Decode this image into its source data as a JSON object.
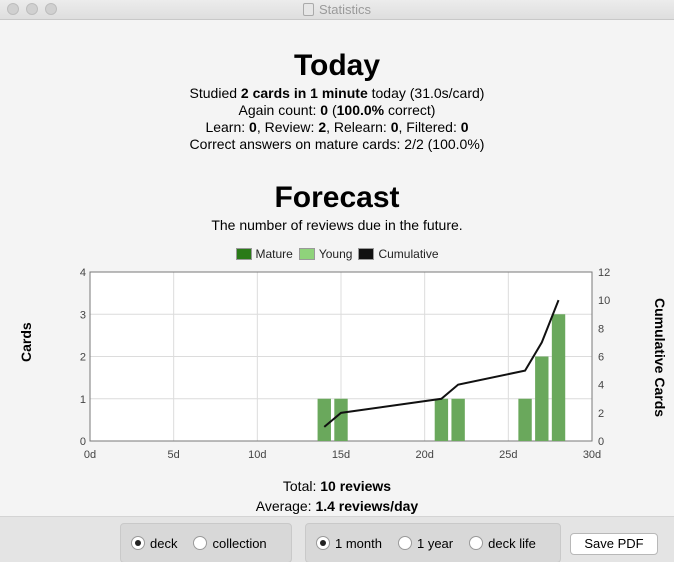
{
  "window": {
    "title": "Statistics"
  },
  "today": {
    "heading": "Today",
    "studied": {
      "prefix": "Studied ",
      "bold": "2 cards in 1 minute",
      "suffix": " today (31.0s/card)"
    },
    "again": {
      "prefix": "Again count: ",
      "count": "0",
      "mid": " (",
      "pct": "100.0%",
      "suffix": " correct)"
    },
    "breakdown": {
      "learn_label": "Learn: ",
      "learn": "0",
      "review_label": ", Review: ",
      "review": "2",
      "relearn_label": ", Relearn: ",
      "relearn": "0",
      "filtered_label": ", Filtered: ",
      "filtered": "0"
    },
    "mature": "Correct answers on mature cards: 2/2 (100.0%)"
  },
  "forecast": {
    "heading": "Forecast",
    "subtitle": "The number of reviews due in the future.",
    "legend": [
      {
        "label": "Mature",
        "color": "#2a7a18"
      },
      {
        "label": "Young",
        "color": "#8fd37b"
      },
      {
        "label": "Cumulative",
        "color": "#111111"
      }
    ],
    "total": {
      "prefix": "Total: ",
      "value": "10 reviews"
    },
    "average": {
      "prefix": "Average: ",
      "value": "1.4 reviews/day"
    }
  },
  "chart_data": {
    "type": "bar",
    "x_ticks": [
      "0d",
      "5d",
      "10d",
      "15d",
      "20d",
      "25d",
      "30d"
    ],
    "xlim": [
      0,
      30
    ],
    "ylabel": "Cards",
    "ylim": [
      0,
      4
    ],
    "y_ticks": [
      "0",
      "1",
      "2",
      "3",
      "4"
    ],
    "y2label": "Cumulative Cards",
    "y2lim": [
      0,
      12
    ],
    "y2_ticks": [
      "0",
      "2",
      "4",
      "6",
      "8",
      "10",
      "12"
    ],
    "grid": true,
    "series": [
      {
        "name": "Young",
        "color": "#6aa85c",
        "points": [
          {
            "x": 14,
            "y": 1
          },
          {
            "x": 15,
            "y": 1
          },
          {
            "x": 21,
            "y": 1
          },
          {
            "x": 22,
            "y": 1
          },
          {
            "x": 26,
            "y": 1
          },
          {
            "x": 27,
            "y": 2
          },
          {
            "x": 28,
            "y": 3
          }
        ]
      },
      {
        "name": "Cumulative",
        "color": "#111111",
        "points": [
          {
            "x": 14,
            "y": 1
          },
          {
            "x": 15,
            "y": 2
          },
          {
            "x": 21,
            "y": 3
          },
          {
            "x": 22,
            "y": 4
          },
          {
            "x": 26,
            "y": 5
          },
          {
            "x": 27,
            "y": 7
          },
          {
            "x": 28,
            "y": 10
          }
        ]
      }
    ]
  },
  "controls": {
    "scope": [
      {
        "label": "deck",
        "selected": true
      },
      {
        "label": "collection",
        "selected": false
      }
    ],
    "period": [
      {
        "label": "1 month",
        "selected": true
      },
      {
        "label": "1 year",
        "selected": false
      },
      {
        "label": "deck life",
        "selected": false
      }
    ],
    "save_label": "Save PDF"
  }
}
